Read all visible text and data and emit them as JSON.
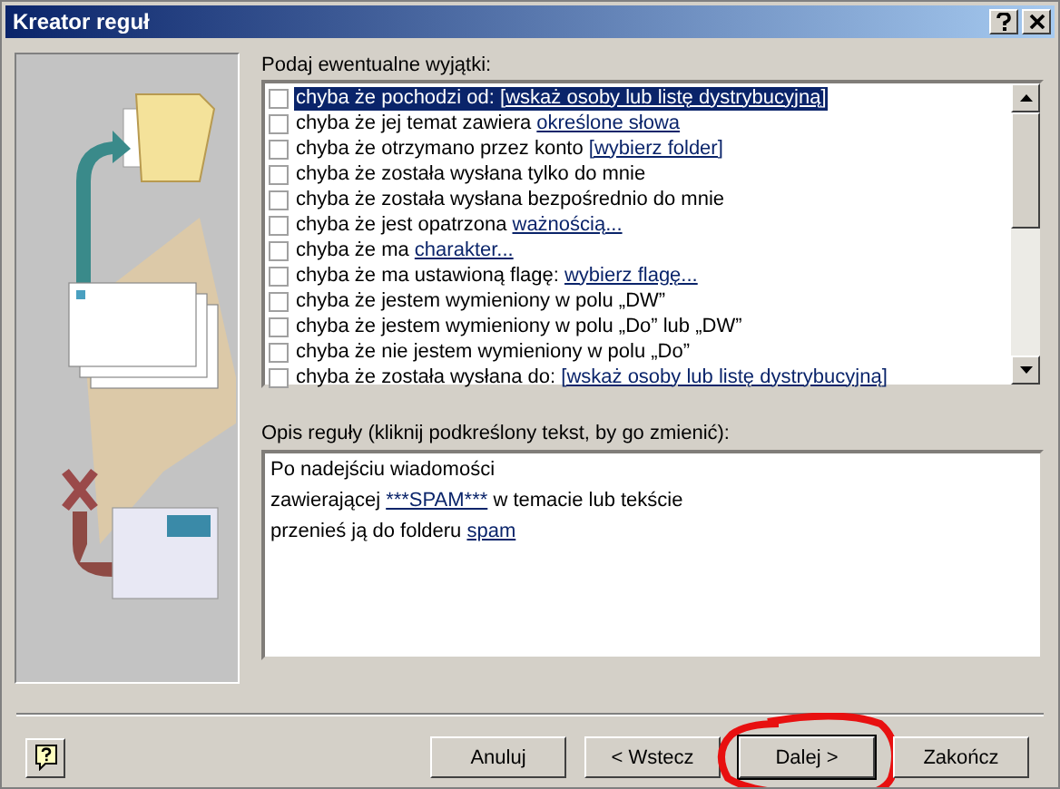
{
  "window": {
    "title": "Kreator reguł"
  },
  "exceptions": {
    "label": "Podaj ewentualne wyjątki:",
    "items": [
      {
        "text": "chyba że pochodzi od: ",
        "link": "[wskaż osoby lub listę dystrybucyjną]",
        "checked": false,
        "selected": true
      },
      {
        "text": "chyba że jej temat zawiera ",
        "link": "określone słowa",
        "checked": false,
        "selected": false
      },
      {
        "text": "chyba że otrzymano przez konto ",
        "link": "[wybierz folder]",
        "checked": false,
        "selected": false
      },
      {
        "text": "chyba że została wysłana tylko do mnie",
        "checked": false,
        "selected": false
      },
      {
        "text": "chyba że została wysłana bezpośrednio do mnie",
        "checked": false,
        "selected": false
      },
      {
        "text": "chyba że jest opatrzona ",
        "link": "ważnością...",
        "checked": false,
        "selected": false
      },
      {
        "text": "chyba że ma ",
        "link": "charakter...",
        "checked": false,
        "selected": false
      },
      {
        "text": "chyba że ma ustawioną flagę: ",
        "link": "wybierz flagę...",
        "checked": false,
        "selected": false
      },
      {
        "text": "chyba że jestem wymieniony w polu „DW”",
        "checked": false,
        "selected": false
      },
      {
        "text": "chyba że jestem wymieniony w polu „Do” lub „DW”",
        "checked": false,
        "selected": false
      },
      {
        "text": "chyba że nie jestem wymieniony w polu „Do”",
        "checked": false,
        "selected": false
      },
      {
        "text": "chyba że została wysłana do: ",
        "link": "[wskaż osoby lub listę dystrybucyjną]",
        "checked": false,
        "selected": false
      }
    ]
  },
  "description": {
    "label": "Opis reguły (kliknij podkreślony tekst, by go zmienić):",
    "lines": [
      {
        "text": "Po nadejściu wiadomości"
      },
      {
        "text": "zawierającej ",
        "link": "***SPAM***",
        "after": " w temacie lub tekście"
      },
      {
        "text": "przenieś ją do folderu ",
        "link": "spam"
      }
    ]
  },
  "buttons": [
    {
      "label": "Anuluj",
      "highlighted": false
    },
    {
      "label": "< Wstecz",
      "highlighted": false
    },
    {
      "label": "Dalej >",
      "highlighted": true
    },
    {
      "label": "Zakończ",
      "highlighted": false
    }
  ]
}
